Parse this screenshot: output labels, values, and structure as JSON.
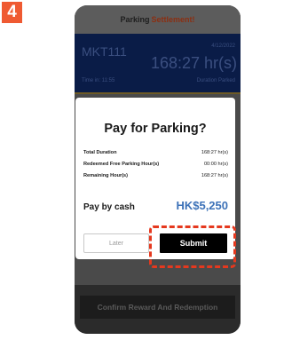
{
  "step_number": "4",
  "header": {
    "title_part1": "Parking",
    "title_part2": "Settlement!"
  },
  "ticket": {
    "plate": "MKT111",
    "date": "4/12/2022",
    "duration": "168:27 hr(s)",
    "time_in": "Time in: 11:55",
    "duration_label": "Duration Parked"
  },
  "dialog": {
    "title": "Pay for Parking?",
    "rows": [
      {
        "label": "Total Duration",
        "value": "168:27 hr(s)"
      },
      {
        "label": "Redeemed Free Parking Hour(s)",
        "value": "00:00 hr(s)"
      },
      {
        "label": "Remaining Hour(s)",
        "value": "168:27 hr(s)"
      }
    ],
    "pay_label": "Pay by cash",
    "pay_amount": "HK$5,250",
    "later_label": "Later",
    "submit_label": "Submit"
  },
  "footer": {
    "confirm_label": "Confirm Reward And Redemption"
  },
  "colors": {
    "step_badge": "#ef5a32",
    "amount": "#3d72b8",
    "highlight": "#e5381e",
    "overlay_blue": "#0a1c47"
  }
}
